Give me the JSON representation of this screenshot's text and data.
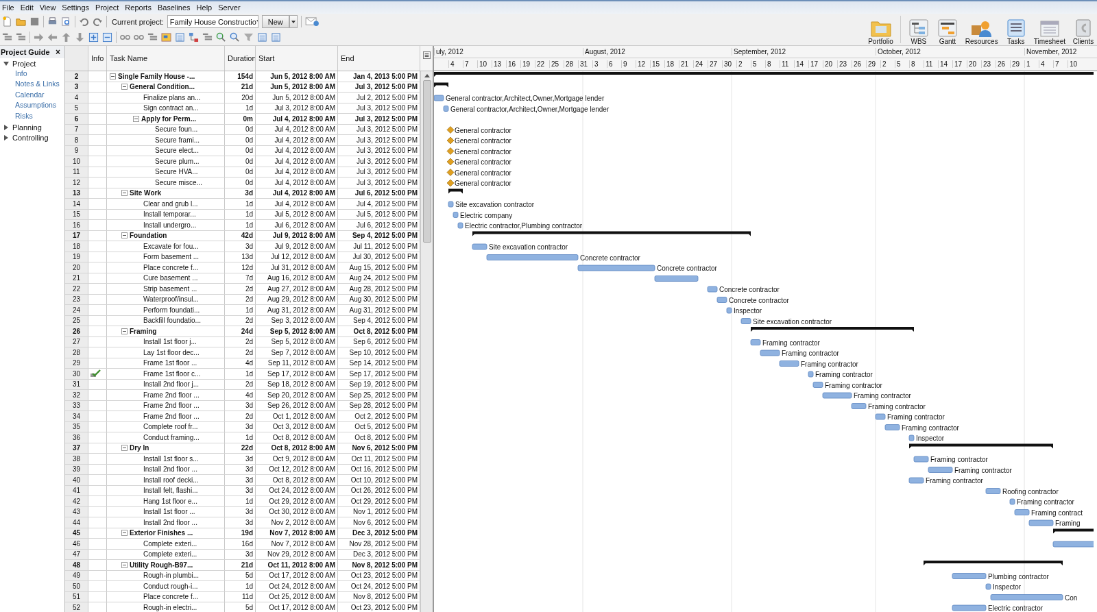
{
  "menu": [
    "File",
    "Edit",
    "View",
    "Settings",
    "Project",
    "Reports",
    "Baselines",
    "Help",
    "Server"
  ],
  "toolbar": {
    "project_label": "Current project:",
    "project": "Family House Constructio",
    "new_button": "New"
  },
  "views": [
    {
      "label": "Portfolio"
    },
    {
      "label": "WBS"
    },
    {
      "label": "Gantt"
    },
    {
      "label": "Resources"
    },
    {
      "label": "Tasks"
    },
    {
      "label": "Timesheet"
    },
    {
      "label": "Clients"
    }
  ],
  "guide": {
    "title": "Project Guide",
    "close": "×",
    "items": [
      {
        "label": "Project",
        "expanded": true,
        "children": [
          {
            "label": "Info"
          },
          {
            "label": "Notes & Links"
          },
          {
            "label": "Calendar"
          },
          {
            "label": "Assumptions"
          },
          {
            "label": "Risks"
          }
        ]
      },
      {
        "label": "Planning",
        "expanded": false
      },
      {
        "label": "Controlling",
        "expanded": false
      }
    ]
  },
  "table": {
    "columns": [
      "Info",
      "Task Name",
      "Duration",
      "Start",
      "End"
    ],
    "tasks": [
      {
        "id": "2",
        "name": "Single Family House -...",
        "duration": "154d",
        "start": "Jun 5, 2012 8:00 AM",
        "end": "Jan 4, 2013 5:00 PM",
        "kind": "summary",
        "expanded": true,
        "has_note": false,
        "children": [
          {
            "id": "3",
            "name": "General Condition...",
            "duration": "21d",
            "start": "Jun 5, 2012 8:00 AM",
            "end": "Jul 3, 2012 5:00 PM",
            "kind": "summary",
            "expanded": true,
            "has_note": false,
            "children": [
              {
                "id": "4",
                "name": "Finalize plans an...",
                "duration": "20d",
                "start": "Jun 5, 2012 8:00 AM",
                "end": "Jul 2, 2012 5:00 PM",
                "kind": "task",
                "has_note": false,
                "resources": "General contractor,Architect,Owner,Mortgage lender"
              },
              {
                "id": "5",
                "name": "Sign contract an...",
                "duration": "1d",
                "start": "Jul 3, 2012 8:00 AM",
                "end": "Jul 3, 2012 5:00 PM",
                "kind": "task",
                "has_note": false,
                "resources": "General contractor,Architect,Owner,Mortgage lender"
              },
              {
                "id": "6",
                "name": "Apply for Perm...",
                "duration": "0m",
                "start": "Jul 4, 2012 8:00 AM",
                "end": "Jul 3, 2012 5:00 PM",
                "kind": "summary",
                "expanded": true,
                "has_note": false,
                "children": [
                  {
                    "id": "7",
                    "name": "Secure foun...",
                    "duration": "0d",
                    "start": "Jul 4, 2012 8:00 AM",
                    "end": "Jul 3, 2012 5:00 PM",
                    "kind": "milestone",
                    "has_note": false,
                    "resources": "General contractor"
                  },
                  {
                    "id": "8",
                    "name": "Secure frami...",
                    "duration": "0d",
                    "start": "Jul 4, 2012 8:00 AM",
                    "end": "Jul 3, 2012 5:00 PM",
                    "kind": "milestone",
                    "has_note": false,
                    "resources": "General contractor"
                  },
                  {
                    "id": "9",
                    "name": "Secure elect...",
                    "duration": "0d",
                    "start": "Jul 4, 2012 8:00 AM",
                    "end": "Jul 3, 2012 5:00 PM",
                    "kind": "milestone",
                    "has_note": false,
                    "resources": "General contractor"
                  },
                  {
                    "id": "10",
                    "name": "Secure plum...",
                    "duration": "0d",
                    "start": "Jul 4, 2012 8:00 AM",
                    "end": "Jul 3, 2012 5:00 PM",
                    "kind": "milestone",
                    "has_note": false,
                    "resources": "General contractor"
                  },
                  {
                    "id": "11",
                    "name": "Secure HVA...",
                    "duration": "0d",
                    "start": "Jul 4, 2012 8:00 AM",
                    "end": "Jul 3, 2012 5:00 PM",
                    "kind": "milestone",
                    "has_note": false,
                    "resources": "General contractor"
                  },
                  {
                    "id": "12",
                    "name": "Secure misce...",
                    "duration": "0d",
                    "start": "Jul 4, 2012 8:00 AM",
                    "end": "Jul 3, 2012 5:00 PM",
                    "kind": "milestone",
                    "has_note": false,
                    "resources": "General contractor"
                  }
                ]
              }
            ]
          },
          {
            "id": "13",
            "name": "Site Work",
            "duration": "3d",
            "start": "Jul 4, 2012 8:00 AM",
            "end": "Jul 6, 2012 5:00 PM",
            "kind": "summary",
            "expanded": true,
            "has_note": false,
            "children": [
              {
                "id": "14",
                "name": "Clear and grub l...",
                "duration": "1d",
                "start": "Jul 4, 2012 8:00 AM",
                "end": "Jul 4, 2012 5:00 PM",
                "kind": "task",
                "has_note": false,
                "resources": "Site excavation contractor"
              },
              {
                "id": "15",
                "name": "Install temporar...",
                "duration": "1d",
                "start": "Jul 5, 2012 8:00 AM",
                "end": "Jul 5, 2012 5:00 PM",
                "kind": "task",
                "has_note": false,
                "resources": "Electric company"
              },
              {
                "id": "16",
                "name": "Install undergro...",
                "duration": "1d",
                "start": "Jul 6, 2012 8:00 AM",
                "end": "Jul 6, 2012 5:00 PM",
                "kind": "task",
                "has_note": false,
                "resources": "Electric contractor,Plumbing contractor"
              }
            ]
          },
          {
            "id": "17",
            "name": "Foundation",
            "duration": "42d",
            "start": "Jul 9, 2012 8:00 AM",
            "end": "Sep 4, 2012 5:00 PM",
            "kind": "summary",
            "expanded": true,
            "has_note": false,
            "children": [
              {
                "id": "18",
                "name": "Excavate for fou...",
                "duration": "3d",
                "start": "Jul 9, 2012 8:00 AM",
                "end": "Jul 11, 2012 5:00 PM",
                "kind": "task",
                "has_note": false,
                "resources": "Site excavation contractor"
              },
              {
                "id": "19",
                "name": "Form basement ...",
                "duration": "13d",
                "start": "Jul 12, 2012 8:00 AM",
                "end": "Jul 30, 2012 5:00 PM",
                "kind": "task",
                "has_note": false,
                "resources": "Concrete contractor"
              },
              {
                "id": "20",
                "name": "Place concrete f...",
                "duration": "12d",
                "start": "Jul 31, 2012 8:00 AM",
                "end": "Aug 15, 2012 5:00 PM",
                "kind": "task",
                "has_note": false,
                "resources": "Concrete contractor"
              },
              {
                "id": "21",
                "name": "Cure basement ...",
                "duration": "7d",
                "start": "Aug 16, 2012 8:00 AM",
                "end": "Aug 24, 2012 5:00 PM",
                "kind": "task",
                "has_note": false
              },
              {
                "id": "22",
                "name": "Strip basement ...",
                "duration": "2d",
                "start": "Aug 27, 2012 8:00 AM",
                "end": "Aug 28, 2012 5:00 PM",
                "kind": "task",
                "has_note": false,
                "resources": "Concrete contractor"
              },
              {
                "id": "23",
                "name": "Waterproof/insul...",
                "duration": "2d",
                "start": "Aug 29, 2012 8:00 AM",
                "end": "Aug 30, 2012 5:00 PM",
                "kind": "task",
                "has_note": false,
                "resources": "Concrete contractor"
              },
              {
                "id": "24",
                "name": "Perform foundati...",
                "duration": "1d",
                "start": "Aug 31, 2012 8:00 AM",
                "end": "Aug 31, 2012 5:00 PM",
                "kind": "task",
                "has_note": false,
                "resources": "Inspector"
              },
              {
                "id": "25",
                "name": "Backfill foundatio...",
                "duration": "2d",
                "start": "Sep 3, 2012 8:00 AM",
                "end": "Sep 4, 2012 5:00 PM",
                "kind": "task",
                "has_note": false,
                "resources": "Site excavation contractor"
              }
            ]
          },
          {
            "id": "26",
            "name": "Framing",
            "duration": "24d",
            "start": "Sep 5, 2012 8:00 AM",
            "end": "Oct 8, 2012 5:00 PM",
            "kind": "summary",
            "expanded": true,
            "has_note": false,
            "children": [
              {
                "id": "27",
                "name": "Install 1st floor j...",
                "duration": "2d",
                "start": "Sep 5, 2012 8:00 AM",
                "end": "Sep 6, 2012 5:00 PM",
                "kind": "task",
                "has_note": false,
                "resources": "Framing contractor"
              },
              {
                "id": "28",
                "name": "Lay 1st floor dec...",
                "duration": "2d",
                "start": "Sep 7, 2012 8:00 AM",
                "end": "Sep 10, 2012 5:00 PM",
                "kind": "task",
                "has_note": false,
                "resources": "Framing contractor"
              },
              {
                "id": "29",
                "name": "Frame 1st floor ...",
                "duration": "4d",
                "start": "Sep 11, 2012 8:00 AM",
                "end": "Sep 14, 2012 5:00 PM",
                "kind": "task",
                "has_note": false,
                "resources": "Framing contractor"
              },
              {
                "id": "30",
                "name": "Frame 1st floor c...",
                "duration": "1d",
                "start": "Sep 17, 2012 8:00 AM",
                "end": "Sep 17, 2012 5:00 PM",
                "kind": "task",
                "has_note": true,
                "resources": "Framing contractor"
              },
              {
                "id": "31",
                "name": "Install 2nd floor j...",
                "duration": "2d",
                "start": "Sep 18, 2012 8:00 AM",
                "end": "Sep 19, 2012 5:00 PM",
                "kind": "task",
                "has_note": false,
                "resources": "Framing contractor"
              },
              {
                "id": "32",
                "name": "Frame 2nd floor ...",
                "duration": "4d",
                "start": "Sep 20, 2012 8:00 AM",
                "end": "Sep 25, 2012 5:00 PM",
                "kind": "task",
                "has_note": false,
                "resources": "Framing contractor"
              },
              {
                "id": "33",
                "name": "Frame 2nd floor ...",
                "duration": "3d",
                "start": "Sep 26, 2012 8:00 AM",
                "end": "Sep 28, 2012 5:00 PM",
                "kind": "task",
                "has_note": false,
                "resources": "Framing contractor"
              },
              {
                "id": "34",
                "name": "Frame 2nd floor ...",
                "duration": "2d",
                "start": "Oct 1, 2012 8:00 AM",
                "end": "Oct 2, 2012 5:00 PM",
                "kind": "task",
                "has_note": false,
                "resources": "Framing contractor"
              },
              {
                "id": "35",
                "name": "Complete roof fr...",
                "duration": "3d",
                "start": "Oct 3, 2012 8:00 AM",
                "end": "Oct 5, 2012 5:00 PM",
                "kind": "task",
                "has_note": false,
                "resources": "Framing contractor"
              },
              {
                "id": "36",
                "name": "Conduct framing...",
                "duration": "1d",
                "start": "Oct 8, 2012 8:00 AM",
                "end": "Oct 8, 2012 5:00 PM",
                "kind": "task",
                "has_note": false,
                "resources": "Inspector"
              }
            ]
          },
          {
            "id": "37",
            "name": "Dry In",
            "duration": "22d",
            "start": "Oct 8, 2012 8:00 AM",
            "end": "Nov 6, 2012 5:00 PM",
            "kind": "summary",
            "expanded": true,
            "has_note": false,
            "children": [
              {
                "id": "38",
                "name": "Install 1st floor s...",
                "duration": "3d",
                "start": "Oct 9, 2012 8:00 AM",
                "end": "Oct 11, 2012 5:00 PM",
                "kind": "task",
                "has_note": false,
                "resources": "Framing contractor"
              },
              {
                "id": "39",
                "name": "Install 2nd floor ...",
                "duration": "3d",
                "start": "Oct 12, 2012 8:00 AM",
                "end": "Oct 16, 2012 5:00 PM",
                "kind": "task",
                "has_note": false,
                "resources": "Framing contractor"
              },
              {
                "id": "40",
                "name": "Install roof decki...",
                "duration": "3d",
                "start": "Oct 8, 2012 8:00 AM",
                "end": "Oct 10, 2012 5:00 PM",
                "kind": "task",
                "has_note": false,
                "resources": "Framing contractor"
              },
              {
                "id": "41",
                "name": "Install felt, flashi...",
                "duration": "3d",
                "start": "Oct 24, 2012 8:00 AM",
                "end": "Oct 26, 2012 5:00 PM",
                "kind": "task",
                "has_note": false,
                "resources": "Roofing contractor"
              },
              {
                "id": "42",
                "name": "Hang 1st floor e...",
                "duration": "1d",
                "start": "Oct 29, 2012 8:00 AM",
                "end": "Oct 29, 2012 5:00 PM",
                "kind": "task",
                "has_note": false,
                "resources": "Framing contractor"
              },
              {
                "id": "43",
                "name": "Install 1st floor ...",
                "duration": "3d",
                "start": "Oct 30, 2012 8:00 AM",
                "end": "Nov 1, 2012 5:00 PM",
                "kind": "task",
                "has_note": false,
                "resources": "Framing contract"
              },
              {
                "id": "44",
                "name": "Install 2nd floor ...",
                "duration": "3d",
                "start": "Nov 2, 2012 8:00 AM",
                "end": "Nov 6, 2012 5:00 PM",
                "kind": "task",
                "has_note": false,
                "resources": "Framing"
              }
            ]
          },
          {
            "id": "45",
            "name": "Exterior Finishes ...",
            "duration": "19d",
            "start": "Nov 7, 2012 8:00 AM",
            "end": "Dec 3, 2012 5:00 PM",
            "kind": "summary",
            "expanded": true,
            "has_note": false,
            "children": [
              {
                "id": "46",
                "name": "Complete exteri...",
                "duration": "16d",
                "start": "Nov 7, 2012 8:00 AM",
                "end": "Nov 28, 2012 5:00 PM",
                "kind": "task",
                "has_note": false
              },
              {
                "id": "47",
                "name": "Complete exteri...",
                "duration": "3d",
                "start": "Nov 29, 2012 8:00 AM",
                "end": "Dec 3, 2012 5:00 PM",
                "kind": "task",
                "has_note": false
              }
            ]
          },
          {
            "id": "48",
            "name": "Utility Rough-B97...",
            "duration": "21d",
            "start": "Oct 11, 2012 8:00 AM",
            "end": "Nov 8, 2012 5:00 PM",
            "kind": "summary",
            "expanded": true,
            "has_note": false,
            "children": [
              {
                "id": "49",
                "name": "Rough-in plumbi...",
                "duration": "5d",
                "start": "Oct 17, 2012 8:00 AM",
                "end": "Oct 23, 2012 5:00 PM",
                "kind": "task",
                "has_note": false,
                "resources": "Plumbing contractor"
              },
              {
                "id": "50",
                "name": "Conduct rough-i...",
                "duration": "1d",
                "start": "Oct 24, 2012 8:00 AM",
                "end": "Oct 24, 2012 5:00 PM",
                "kind": "task",
                "has_note": false,
                "resources": "Inspector"
              },
              {
                "id": "51",
                "name": "Place concrete f...",
                "duration": "11d",
                "start": "Oct 25, 2012 8:00 AM",
                "end": "Nov 8, 2012 5:00 PM",
                "kind": "task",
                "has_note": false,
                "resources": "Con"
              },
              {
                "id": "52",
                "name": "Rough-in electri...",
                "duration": "5d",
                "start": "Oct 17, 2012 8:00 AM",
                "end": "Oct 23, 2012 5:00 PM",
                "kind": "task",
                "has_note": false,
                "resources": "Electric contractor"
              }
            ]
          }
        ]
      }
    ]
  },
  "gantt": {
    "months": [
      "uly, 2012",
      "August, 2012",
      "September, 2012",
      "October, 2012",
      "November, 2012"
    ],
    "days": [
      "4",
      "7",
      "10",
      "13",
      "16",
      "19",
      "22",
      "25",
      "28",
      "31",
      "3",
      "6",
      "9",
      "12",
      "15",
      "18",
      "21",
      "24",
      "27",
      "30",
      "2",
      "5",
      "8",
      "11",
      "14",
      "17",
      "20",
      "23",
      "26",
      "29",
      "2",
      "5",
      "8",
      "11",
      "14",
      "17",
      "20",
      "23",
      "26",
      "29",
      "1",
      "4",
      "7",
      "10"
    ]
  }
}
